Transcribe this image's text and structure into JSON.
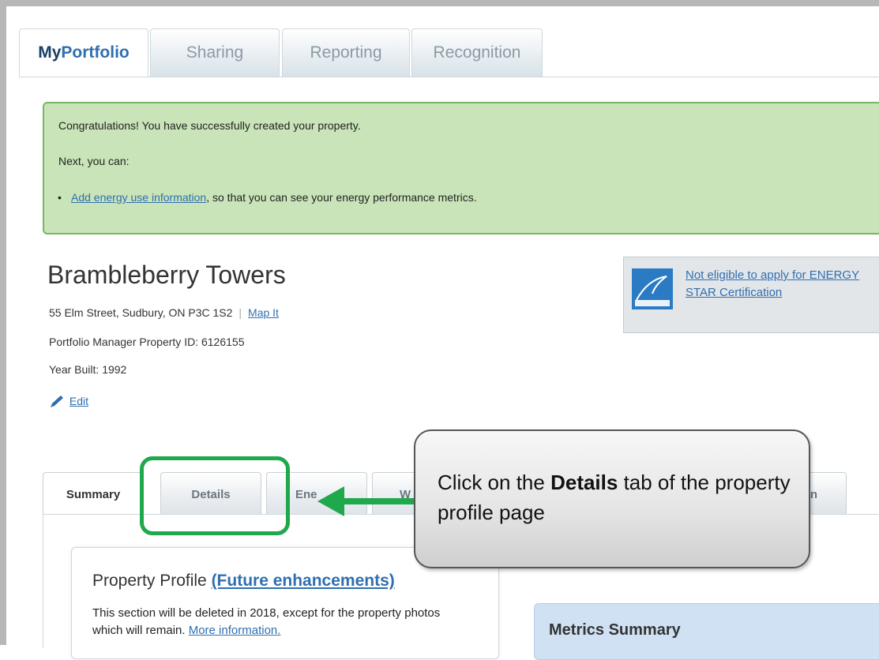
{
  "top_tabs": [
    {
      "prefix": "My",
      "label": "Portfolio"
    },
    {
      "label": "Sharing"
    },
    {
      "label": "Reporting"
    },
    {
      "label": "Recognition"
    }
  ],
  "alert": {
    "line1": "Congratulations! You have successfully created your property.",
    "line2": "Next, you can:",
    "bullet_link": "Add energy use information",
    "bullet_rest": ", so that you can see your energy performance metrics."
  },
  "property": {
    "name": "Brambleberry Towers",
    "address": "55 Elm Street, Sudbury, ON P3C 1S2",
    "separator": "|",
    "map_link": "Map It",
    "id_line": "Portfolio Manager Property ID: 6126155",
    "year_line": "Year Built: 1992",
    "edit_link": "Edit"
  },
  "energy_star": {
    "text": "Not eligible to apply for ENERGY STAR Certification"
  },
  "lower_tabs": [
    {
      "label": "Summary"
    },
    {
      "label": "Details"
    },
    {
      "label": "Ene"
    },
    {
      "label": "W"
    },
    {
      "label": "n"
    }
  ],
  "callout": {
    "pre": "Click on the ",
    "bold": "Details",
    "post": " tab of the property profile page"
  },
  "profile_panel": {
    "title": "Property Profile ",
    "title_link": "(Future enhancements)",
    "text": "This section will be deleted in 2018, except for the property photos which will remain. ",
    "text_link": "More information."
  },
  "metrics": {
    "title": "Metrics Summary"
  },
  "colors": {
    "highlight_green": "#1fa84c",
    "alert_bg": "#c9e4b8",
    "link_blue": "#2f6fb0"
  }
}
